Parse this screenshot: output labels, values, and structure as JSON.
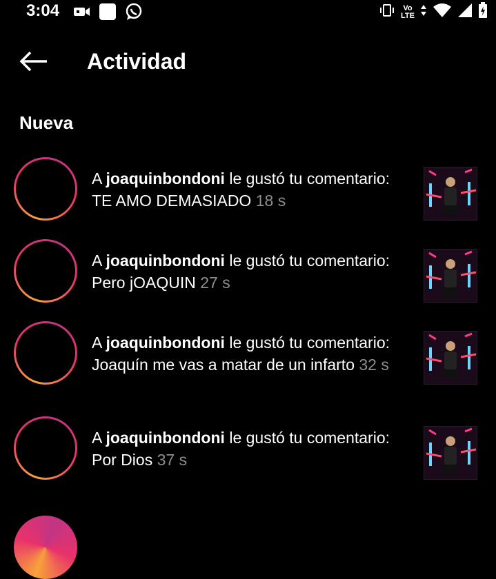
{
  "status_bar": {
    "time": "3:04",
    "network_top": "Vo",
    "network_bottom": "LTE",
    "icons": [
      "video-camera-icon",
      "square-app-icon",
      "whatsapp-icon",
      "vibrate-icon",
      "volte-icon",
      "data-arrows-icon",
      "wifi-icon",
      "signal-icon",
      "battery-charging-icon"
    ]
  },
  "header": {
    "title": "Actividad",
    "back_icon": "arrow-left-icon"
  },
  "section": {
    "label": "Nueva"
  },
  "notifications": [
    {
      "prefix": "A ",
      "user": "joaquinbondoni",
      "action": " le gustó tu comentario: TE AMO DEMASIADO",
      "time": "18 s"
    },
    {
      "prefix": "A ",
      "user": "joaquinbondoni",
      "action": " le gustó tu comentario: Pero jOAQUIN",
      "time": "27 s"
    },
    {
      "prefix": "A ",
      "user": "joaquinbondoni",
      "action": " le gustó tu comentario: Joaquín me vas a matar de un infarto",
      "time": "32 s"
    },
    {
      "prefix": "A ",
      "user": "joaquinbondoni",
      "action": " le gustó tu comentario: Por Dios",
      "time": "37 s"
    }
  ],
  "colors": {
    "background": "#000000",
    "text": "#ffffff",
    "timestamp": "#8e8e8e",
    "ring_start": "#f7a23b",
    "ring_end": "#c13584"
  }
}
